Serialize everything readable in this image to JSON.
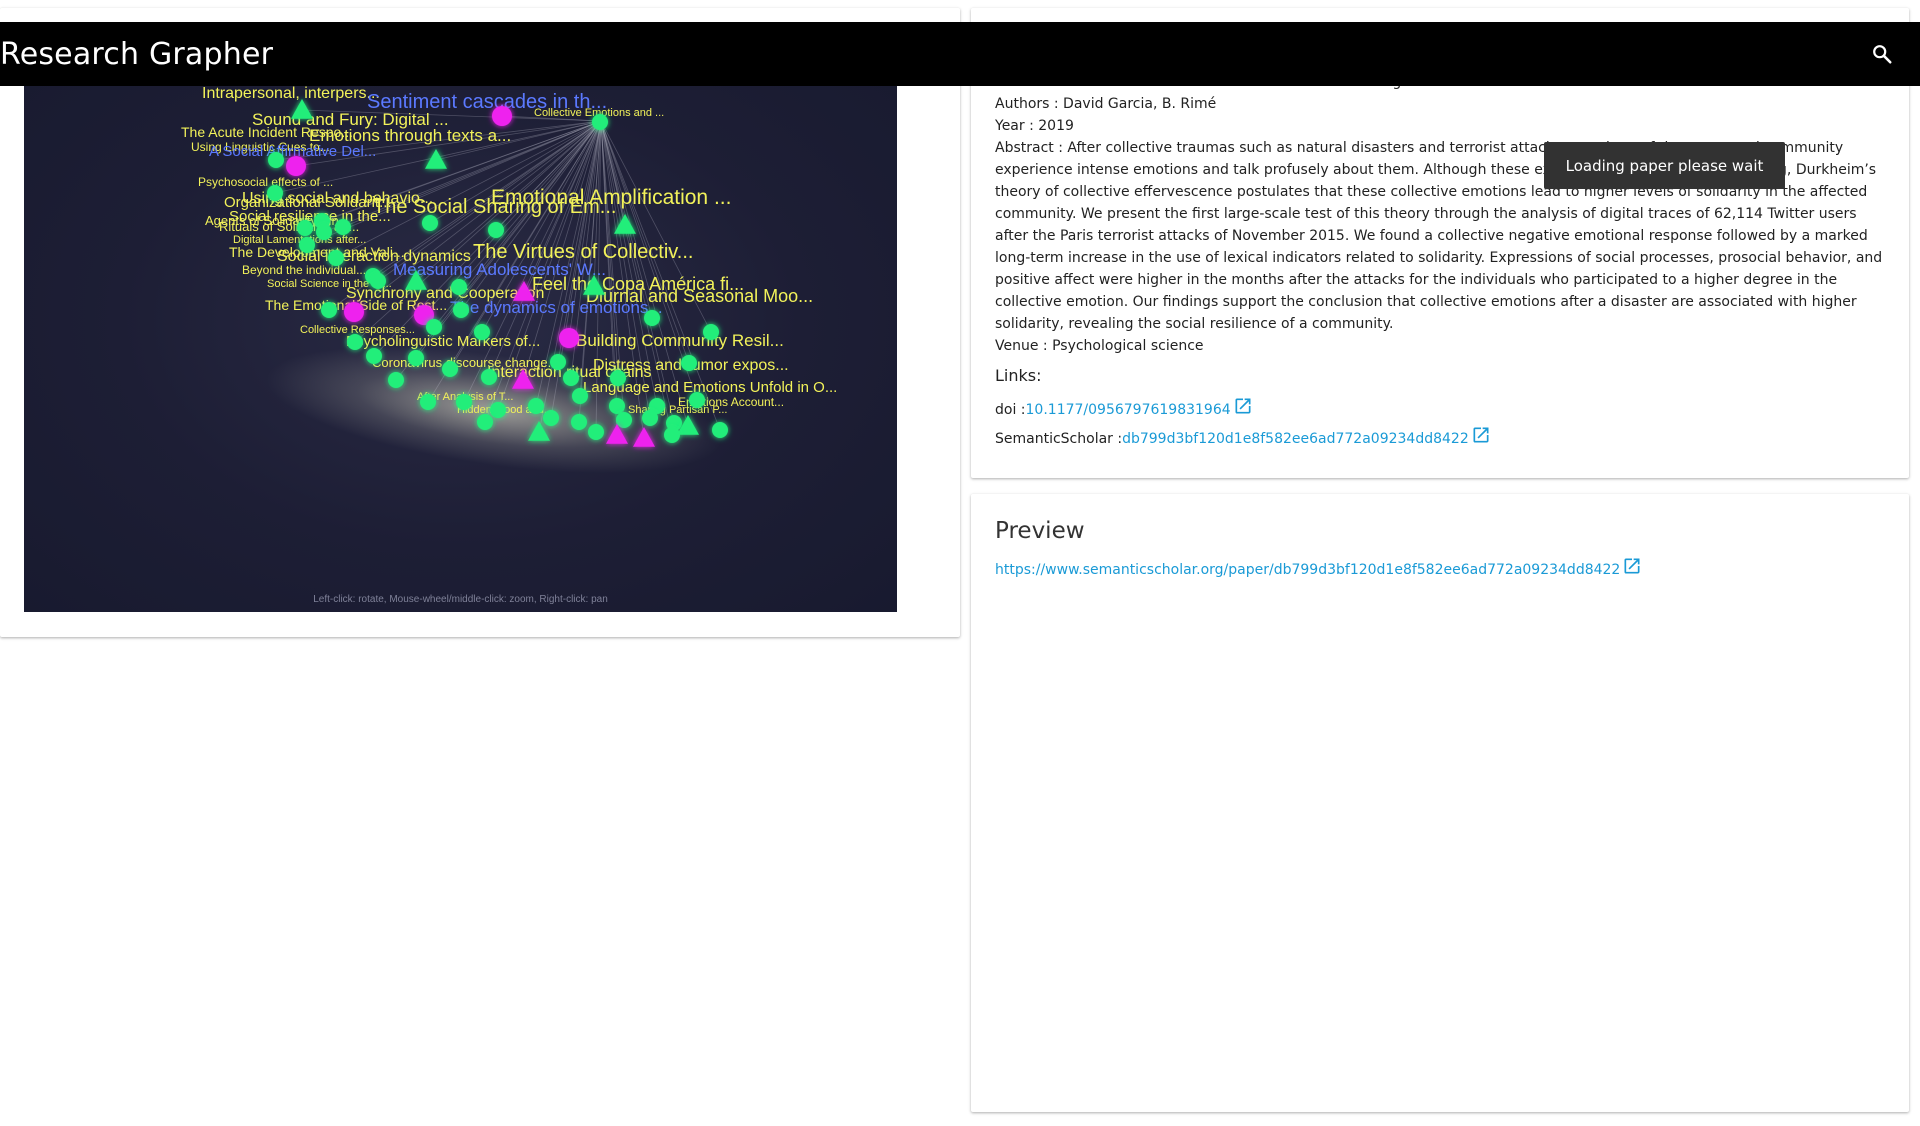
{
  "app": {
    "title": "Research Grapher",
    "search_icon": "search-icon"
  },
  "graph": {
    "hint": "Left-click: rotate, Mouse-wheel/middle-click: zoom, Right-click: pan",
    "colors": {
      "background": "#1d1e35",
      "node_green": "#22ee7a",
      "node_magenta": "#ee22ee",
      "label_yellow": "#f2f25a",
      "label_blue": "#5b79ff",
      "edge": "#c8c8d8"
    },
    "labels": [
      {
        "text": "Intrapersonal, interpers...",
        "color": "yellow"
      },
      {
        "text": "Sentiment cascades in th...",
        "color": "blue"
      },
      {
        "text": "Collective Emotions and ...",
        "color": "yellow"
      },
      {
        "text": "Sound and Fury: Digital ...",
        "color": "yellow"
      },
      {
        "text": "The Acute Incident Respo...",
        "color": "yellow"
      },
      {
        "text": "Emotions through texts a...",
        "color": "yellow"
      },
      {
        "text": "Using Linguistic Cues to...",
        "color": "yellow"
      },
      {
        "text": "A Social Affirmative Del...",
        "color": "blue"
      },
      {
        "text": "Psychosocial effects of ...",
        "color": "yellow"
      },
      {
        "text": "Using social and behavio...",
        "color": "yellow"
      },
      {
        "text": "Emotional Amplification ...",
        "color": "yellow"
      },
      {
        "text": "Organizational Solidarit...",
        "color": "yellow"
      },
      {
        "text": "The Social Sharing of Em...",
        "color": "yellow"
      },
      {
        "text": "Social resilience in the...",
        "color": "yellow"
      },
      {
        "text": "Agents of Solidarity Fin...",
        "color": "yellow"
      },
      {
        "text": "Rituals of Solidarity au...",
        "color": "yellow"
      },
      {
        "text": "Digital Lamentations after...",
        "color": "yellow"
      },
      {
        "text": "The Development and Vali...",
        "color": "yellow"
      },
      {
        "text": "The Virtues of Collectiv...",
        "color": "yellow"
      },
      {
        "text": "Social interaction dynamics",
        "color": "yellow"
      },
      {
        "text": "Measuring Adolescents' W...",
        "color": "blue"
      },
      {
        "text": "Beyond the individual...",
        "color": "yellow"
      },
      {
        "text": "Feel the Copa América fi...",
        "color": "yellow"
      },
      {
        "text": "Social Science in the Er...",
        "color": "yellow"
      },
      {
        "text": "Synchrony and Cooperation",
        "color": "yellow"
      },
      {
        "text": "Diurnal and Seasonal Moo...",
        "color": "yellow"
      },
      {
        "text": "The dynamics of emotions...",
        "color": "blue"
      },
      {
        "text": "The Emotional Side of Rest...",
        "color": "yellow"
      },
      {
        "text": "Collective Responses...",
        "color": "yellow"
      },
      {
        "text": "Psycholinguistic Markers of...",
        "color": "yellow"
      },
      {
        "text": "Building Community Resil...",
        "color": "yellow"
      },
      {
        "text": "Distress and rumor expos...",
        "color": "yellow"
      },
      {
        "text": "Interaction ritual chains",
        "color": "yellow"
      },
      {
        "text": "Coronavirus discourse change...",
        "color": "yellow"
      },
      {
        "text": "Language and Emotions Unfold in O...",
        "color": "yellow"
      },
      {
        "text": "Emotions Account...",
        "color": "yellow"
      },
      {
        "text": "After Analysis of T...",
        "color": "yellow"
      },
      {
        "text": "Hidden Mood and...",
        "color": "yellow"
      },
      {
        "text": "Sharing Partisan P...",
        "color": "yellow"
      }
    ]
  },
  "paper": {
    "title_line": "Title : Collective Emotions and Social Resilience in the Digital Traces After a Terrorist Attack",
    "authors": "Authors : David Garcia, B. Rimé",
    "year": "Year : 2019",
    "abstract": "Abstract : After collective traumas such as natural disasters and terrorist attacks, members of the concerned community experience intense emotions and talk profusely about them. Although these exchanges resemble simple venting, Durkheim’s theory of collective effervescence postulates that these collective emotions lead to higher levels of solidarity in the affected community. We present the first large-scale test of this theory through the analysis of digital traces of 62,114 Twitter users after the Paris terrorist attacks of November 2015. We found a collective negative emotional response followed by a marked long-term increase in the use of lexical indicators related to solidarity. Expressions of social processes, prosocial behavior, and positive affect were higher in the months after the attacks for the individuals who participated to a higher degree in the collective emotion. Our findings support the conclusion that collective emotions after a disaster are associated with higher solidarity, revealing the social resilience of a community.",
    "venue": "Venue : Psychological science",
    "links_heading": "Links:",
    "doi_label": "doi :",
    "doi_value": "10.1177/0956797619831964",
    "ss_label": "SemanticScholar :",
    "ss_value": "db799d3bf120d1e8f582ee6ad772a09234dd8422",
    "link_icon": "open-in-new-icon"
  },
  "preview": {
    "title": "Preview",
    "url": "https://www.semanticscholar.org/paper/db799d3bf120d1e8f582ee6ad772a09234dd8422"
  },
  "snackbar": {
    "message": "Loading paper please wait"
  }
}
